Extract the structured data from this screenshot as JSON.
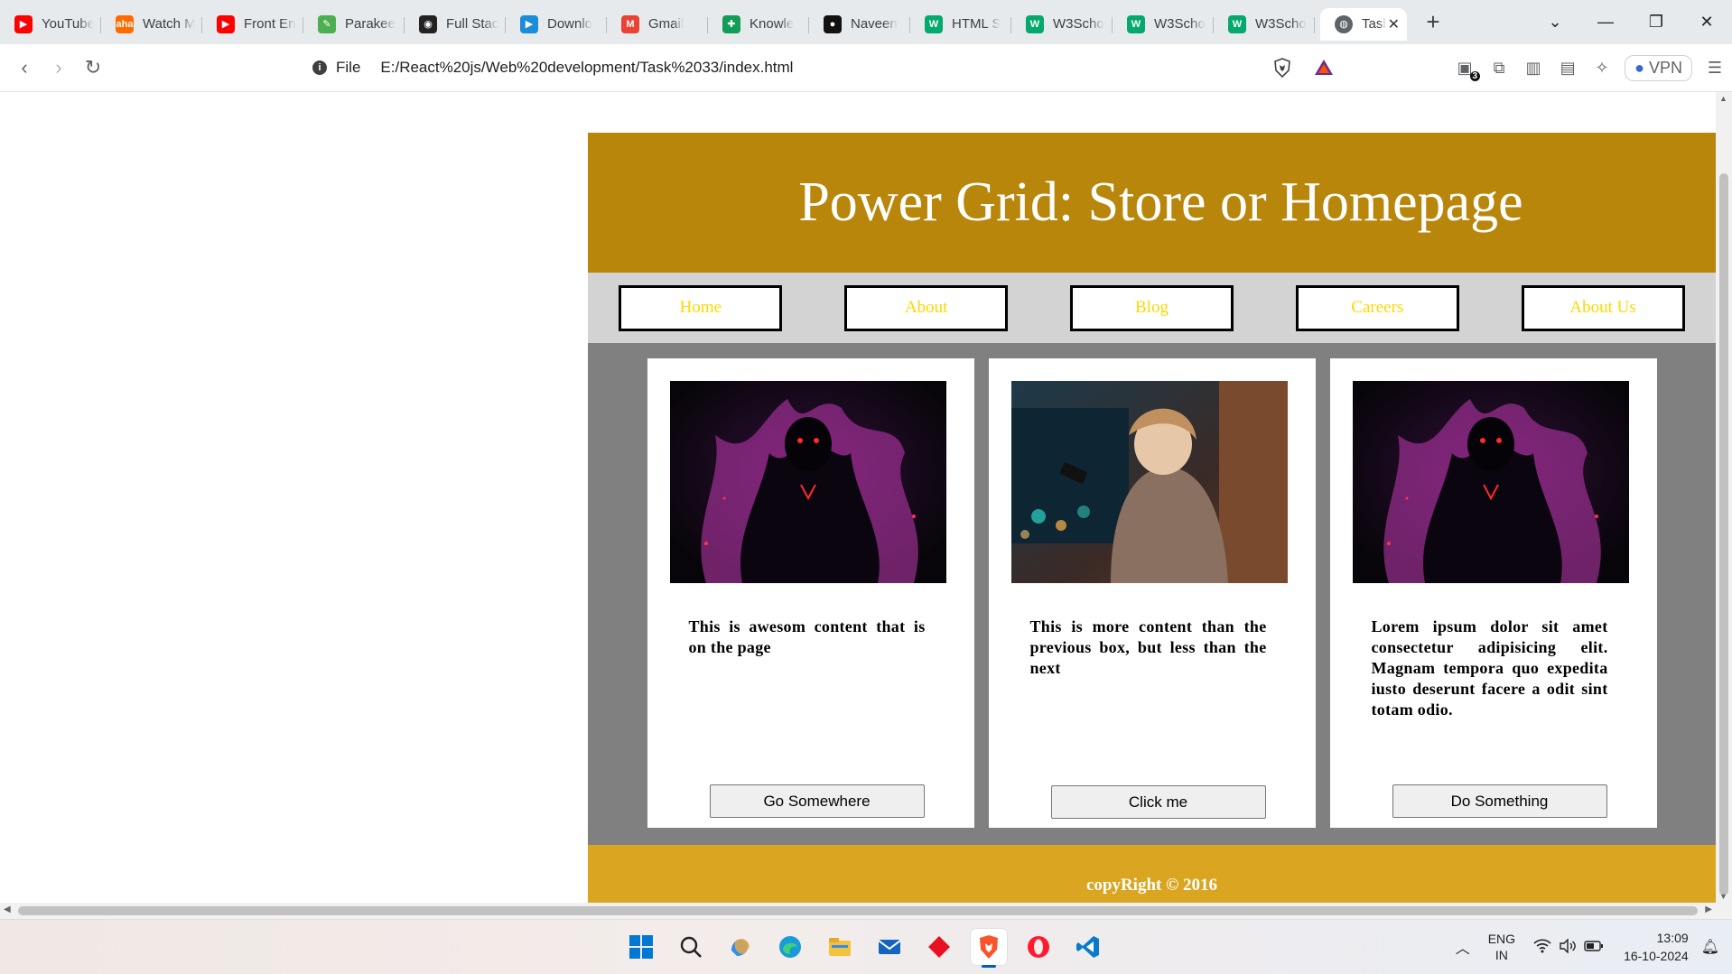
{
  "browser": {
    "tabs": [
      {
        "title": "YouTube",
        "icon": "youtube-icon",
        "color": "#ff0000"
      },
      {
        "title": "Watch M",
        "icon": "aha-icon",
        "color": "#ff6a00"
      },
      {
        "title": "Front En",
        "icon": "youtube-icon",
        "color": "#ff0000"
      },
      {
        "title": "Parakee",
        "icon": "parakeet-icon",
        "color": "#4caf50"
      },
      {
        "title": "Full Stac",
        "icon": "fullstack-icon",
        "color": "#222222"
      },
      {
        "title": "Downlo",
        "icon": "play-icon",
        "color": "#1a8cd8"
      },
      {
        "title": "Gmail",
        "icon": "gmail-icon",
        "color": "#ea4335"
      },
      {
        "title": "Knowle",
        "icon": "sheet-icon",
        "color": "#0f9d58"
      },
      {
        "title": "Naveen",
        "icon": "github-icon",
        "color": "#111111"
      },
      {
        "title": "HTML S",
        "icon": "w3schools-icon",
        "color": "#04aa6d"
      },
      {
        "title": "W3Scho",
        "icon": "w3schools-icon",
        "color": "#04aa6d"
      },
      {
        "title": "W3Scho",
        "icon": "w3schools-icon",
        "color": "#04aa6d"
      },
      {
        "title": "W3Scho",
        "icon": "w3schools-icon",
        "color": "#04aa6d"
      }
    ],
    "active_tab": {
      "title": "Tasl",
      "icon": "globe-icon"
    },
    "address": {
      "scheme": "File",
      "url": "E:/React%20js/Web%20development/Task%2033/index.html"
    },
    "vpn_label": "VPN",
    "extension_badge": "3"
  },
  "site": {
    "header_title": "Power Grid: Store or Homepage",
    "nav": [
      "Home",
      "About",
      "Blog",
      "Careers",
      "About Us"
    ],
    "cards": [
      {
        "image": "dark-demon-artwork",
        "text": "This is awesom content that is on the page",
        "button": "Go Somewhere"
      },
      {
        "image": "boy-with-phone-artwork",
        "text": "This is more content than the previous box, but less than the next",
        "button": "Click me"
      },
      {
        "image": "dark-demon-artwork",
        "text": "Lorem ipsum dolor sit amet consectetur adipisicing elit. Magnam tempora quo expedita iusto deserunt facere a odit sint totam odio.",
        "button": "Do Something"
      }
    ],
    "footer": "copyRight © 2016",
    "colors": {
      "header": "#b8860b",
      "nav_bg": "#d3d3d3",
      "nav_text": "#ffd700",
      "cards_bg": "#808080",
      "footer": "#daa520"
    }
  },
  "taskbar": {
    "lang_line1": "ENG",
    "lang_line2": "IN",
    "time": "13:09",
    "date": "16-10-2024"
  }
}
